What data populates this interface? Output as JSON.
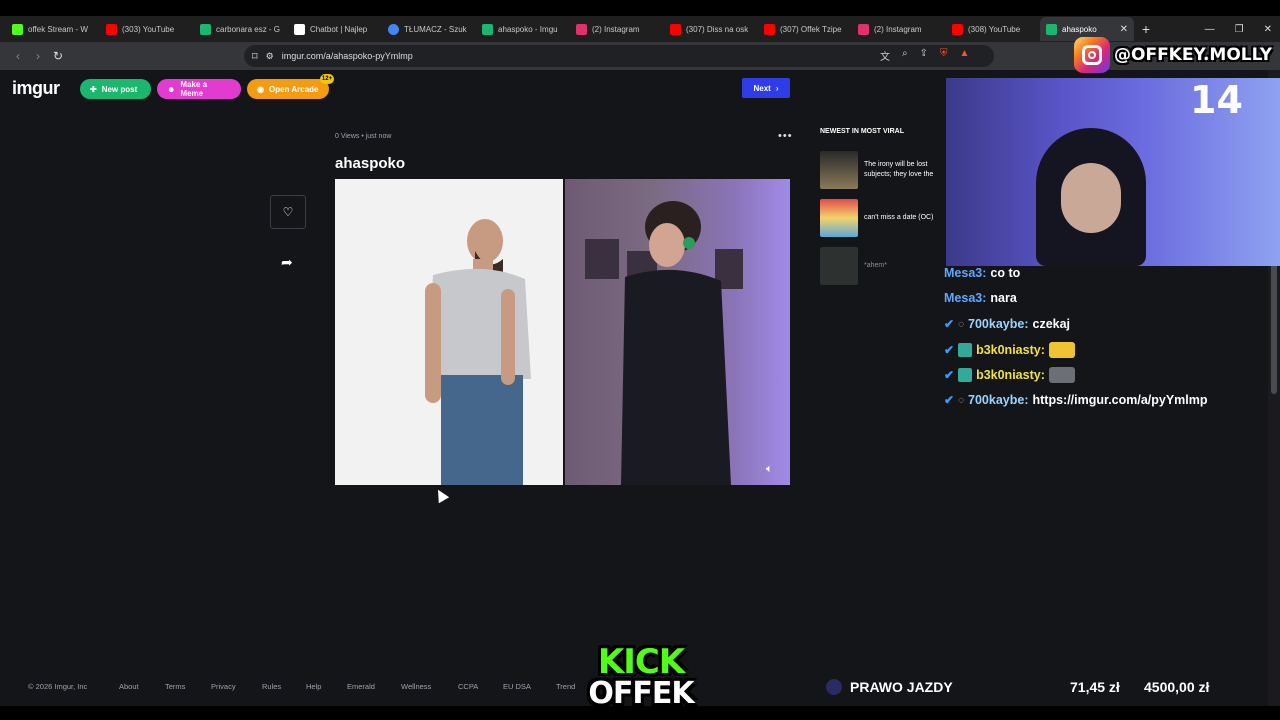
{
  "browser": {
    "tabs": [
      {
        "label": "offek Stream - W",
        "color": "#53fc18"
      },
      {
        "label": "(303) YouTube",
        "color": "#ff0000"
      },
      {
        "label": "carbonara esz - G",
        "color": "#1bb76e"
      },
      {
        "label": "Chatbot | Najlep",
        "color": "#ffffff"
      },
      {
        "label": "TŁUMACZ - Szuk",
        "color": "#4285f4"
      },
      {
        "label": "ahaspoko - Imgu",
        "color": "#1bb76e"
      },
      {
        "label": "(2) Instagram",
        "color": "#e1306c"
      },
      {
        "label": "(307) Diss na osk",
        "color": "#ff0000"
      },
      {
        "label": "(307) Offek Tzipe",
        "color": "#ff0000"
      },
      {
        "label": "(2) Instagram",
        "color": "#e1306c"
      },
      {
        "label": "(308) YouTube",
        "color": "#ff0000"
      },
      {
        "label": "ahaspoko",
        "color": "#1bb76e",
        "active": true
      }
    ],
    "url": "imgur.com/a/ahaspoko-pyYmlmp"
  },
  "imgur": {
    "logo": "imgur",
    "new_post": "New post",
    "make_meme": "Make a Meme",
    "open_arcade": "Open Arcade",
    "arcade_badge": "12+",
    "next": "Next",
    "meta": "0 Views • just now",
    "post_title": "ahaspoko",
    "sidebar_heading": "NEWEST IN MOST VIRAL",
    "sidebar_items": [
      {
        "text": "The irony will be lost subjects; they love the"
      },
      {
        "text": "can't miss a date (OC)"
      },
      {
        "text": "*ahem*"
      }
    ],
    "footer": [
      "© 2026 Imgur, Inc",
      "About",
      "Terms",
      "Privacy",
      "Rules",
      "Help",
      "Emerald",
      "Wellness",
      "CCPA",
      "EU DSA",
      "Trend"
    ]
  },
  "overlay": {
    "instagram_handle": "@OFFKEY.MOLLY",
    "cam_counter": "14",
    "kick_line1": "KICK",
    "kick_line2": "OFFEK",
    "goal_title": "PRAWO JAZDY",
    "goal_current": "71,45 zł",
    "goal_max": "4500,00 zł"
  },
  "chat": [
    {
      "user": "Mesa3",
      "message": "co to"
    },
    {
      "user": "Mesa3",
      "message": "nara"
    },
    {
      "user": "700kaybe",
      "message": "czekaj"
    },
    {
      "user": "b3k0niasty",
      "message": ""
    },
    {
      "user": "b3k0niasty",
      "message": ""
    },
    {
      "user": "700kaybe",
      "message": "https://imgur.com/a/pyYmlmp"
    }
  ]
}
